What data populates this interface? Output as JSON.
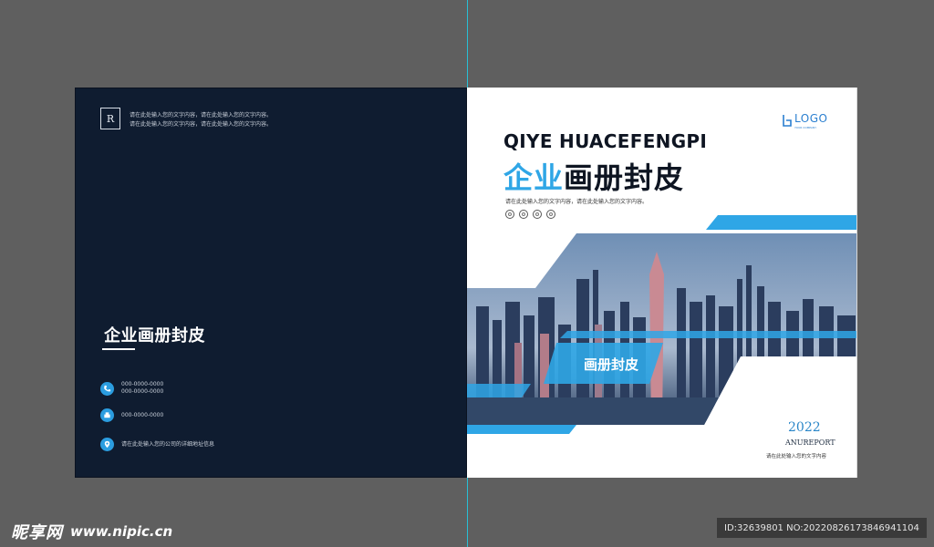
{
  "left_cover": {
    "badge": "R",
    "header_lines": [
      "请在此处输入您的文字内容，请在此处输入您的文字内容。",
      "请在此处输入您的文字内容，请在此处输入您的文字内容。"
    ],
    "title": "企业画册封皮",
    "contacts": [
      {
        "icon": "phone-icon",
        "lines": [
          "000-0000-0000",
          "000-0000-0000"
        ]
      },
      {
        "icon": "fax-icon",
        "lines": [
          "000-0000-0000"
        ]
      },
      {
        "icon": "location-pin-icon",
        "lines": [
          "请在此处输入您的公司的详细地址信息"
        ]
      }
    ]
  },
  "right_cover": {
    "logo": {
      "word": "LOGO",
      "sub": "YOUR COMPANY"
    },
    "en_title": "QIYE HUACEFENGPI",
    "cn_title_blue": "企业",
    "cn_title_dark": "画册封皮",
    "subtitle": "请在此处输入您的文字内容，请在此处输入您的文字内容。",
    "social_icons": [
      "weibo-icon",
      "user-icon",
      "location-icon",
      "send-icon"
    ],
    "band_label": "画册封皮",
    "year": "2022",
    "report": "ANUREPORT",
    "bottom_text": "请在此处输入您的文字内容"
  },
  "colors": {
    "accent": "#2fa6e6",
    "navy": "#0f1c30",
    "background": "#5f5f5f",
    "guide": "#27c0d6"
  },
  "watermark": {
    "brand": "昵享网",
    "url": "www.nipic.cn",
    "id_text": "ID:32639801 NO:20220826173846941104"
  }
}
